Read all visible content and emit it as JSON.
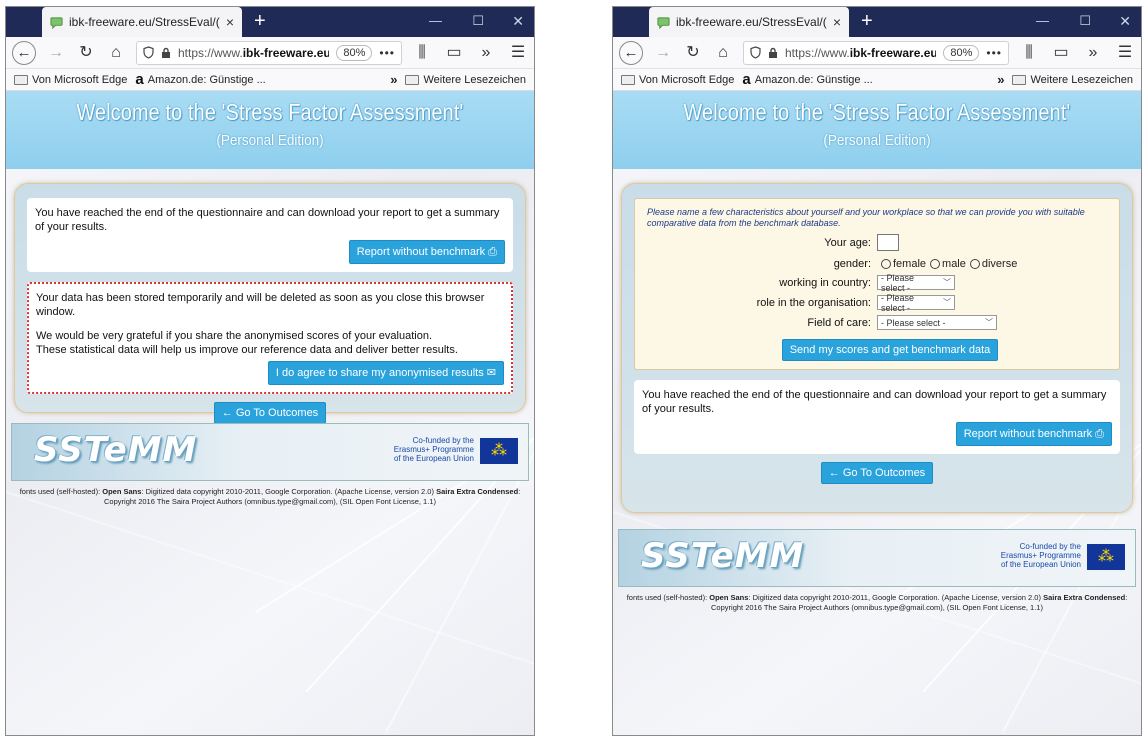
{
  "browser": {
    "tab_title": "ibk-freeware.eu/StressEval/(S(2",
    "tab_close": "×",
    "new_tab": "+",
    "win_minimize": "—",
    "win_maximize": "☐",
    "win_close": "✕",
    "url_prefix": "https://www.",
    "url_domain": "ibk-freeware.eu",
    "url_suffix": "/",
    "zoom": "80%",
    "page_actions": "•••",
    "bookmarks": {
      "edge": "Von Microsoft Edge",
      "amazon": "Amazon.de: Günstige ...",
      "more": "»",
      "other": "Weitere Lesezeichen"
    }
  },
  "header": {
    "title": "Welcome to the 'Stress Factor Assessment'",
    "subtitle": "(Personal Edition)"
  },
  "left_page": {
    "end_message": "You have reached the end of the questionnaire and can download your report to get a summary of your results.",
    "report_button": "Report without benchmark ⎙",
    "stored_notice": "Your data has been stored temporarily and will be deleted as soon as you close this browser window.",
    "share_request": "We would be very grateful if you share the anonymised scores of your evaluation.",
    "share_reason": "These statistical data will help us improve our reference data and deliver better results.",
    "agree_button": "I do agree to share my anonymised results ✉",
    "outcomes_button": "← Go To Outcomes"
  },
  "right_page": {
    "intro": "Please name a few characteristics about yourself and your workplace so that we can provide you with suitable comparative data from the benchmark database.",
    "age_label": "Your age:",
    "gender_label": "gender:",
    "gender_options": [
      "female",
      "male",
      "diverse"
    ],
    "country_label": "working in country:",
    "role_label": "role in the organisation:",
    "field_label": "Field of care:",
    "select_placeholder": "- Please select -",
    "submit_button": "Send my scores and get benchmark data",
    "end_message": "You have reached the end of the questionnaire and can download your report to get a summary of your results.",
    "report_button": "Report without benchmark ⎙",
    "outcomes_button": "← Go To Outcomes"
  },
  "footer": {
    "logo": "SSTeMM",
    "erasmus_line1": "Co-funded by the",
    "erasmus_line2": "Erasmus+ Programme",
    "erasmus_line3": "of the European Union",
    "credits_prefix": "fonts used (self-hosted): ",
    "credits_font1": "Open Sans",
    "credits_font1_text": ": Digitized data copyright 2010-2011, Google Corporation. (Apache License, version 2.0) ",
    "credits_font2": "Saira Extra Condensed",
    "credits_font2_text": ": Copyright 2016 The Saira Project Authors (omnibus.type@gmail.com), (SIL Open Font License, 1.1)"
  }
}
